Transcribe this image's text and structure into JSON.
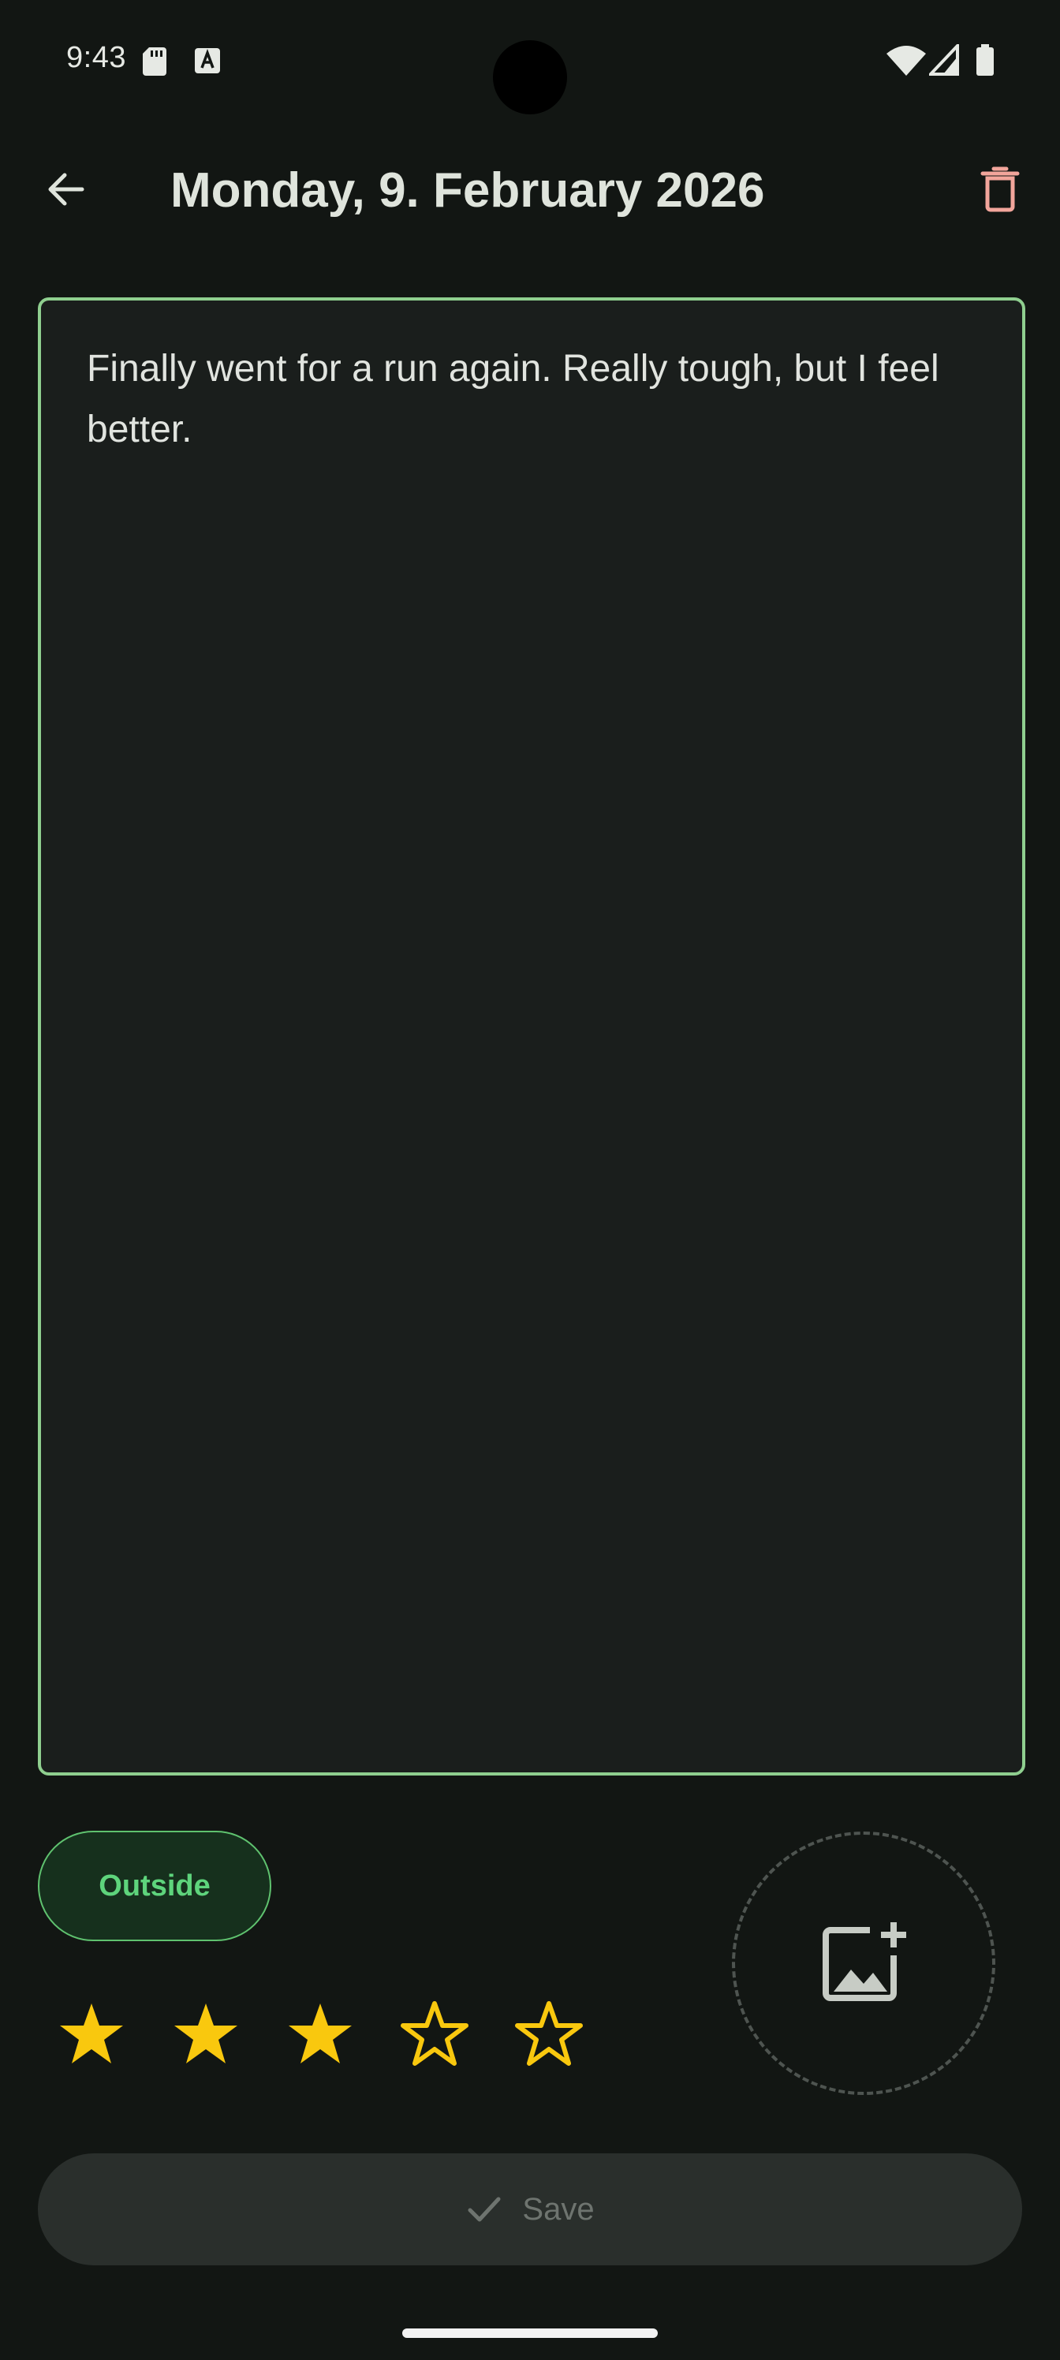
{
  "status_bar": {
    "time": "9:43",
    "icons": [
      "sd-card-icon",
      "text-a-icon",
      "wifi-icon",
      "cell-signal-icon",
      "battery-icon"
    ]
  },
  "app_bar": {
    "back_icon": "arrow-back-icon",
    "title": "Monday, 9. February 2026",
    "delete_icon": "trash-icon"
  },
  "entry": {
    "text": "Finally went for a run again. Really tough, but I feel better."
  },
  "tags": [
    {
      "label": "Outside",
      "selected": true
    }
  ],
  "add_image": {
    "icon": "add-photo-icon"
  },
  "rating": {
    "value": 3,
    "max": 5
  },
  "save": {
    "label": "Save",
    "icon": "check-icon",
    "enabled": false
  },
  "colors": {
    "background": "#121613",
    "accent_border": "#8fcf8f",
    "chip_text": "#5ed47c",
    "star": "#f9c80e",
    "delete": "#f2a59b"
  }
}
